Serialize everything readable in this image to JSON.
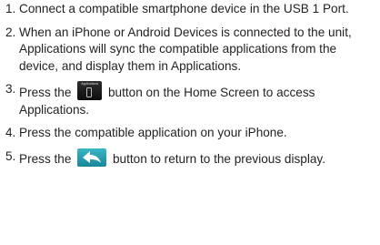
{
  "steps": [
    {
      "number": "1.",
      "text": "Connect a compatible smartphone device in the USB 1 Port."
    },
    {
      "number": "2.",
      "text": "When an iPhone or Android Devices is connected to the unit, Applications will sync the compatible applications from the device, and display them in Applications."
    },
    {
      "number": "3.",
      "text_before": "Press the",
      "icon_label": "Applications",
      "text_after": "button on the Home Screen to access Applications."
    },
    {
      "number": "4.",
      "text": "Press the compatible application on your iPhone."
    },
    {
      "number": "5.",
      "text_before": "Press the",
      "text_after": "button to return to the previous display."
    }
  ],
  "icons": {
    "applications_button": "phone-icon",
    "back_button": "back-arrow-icon",
    "back_button_color": "#2a9fb0"
  }
}
